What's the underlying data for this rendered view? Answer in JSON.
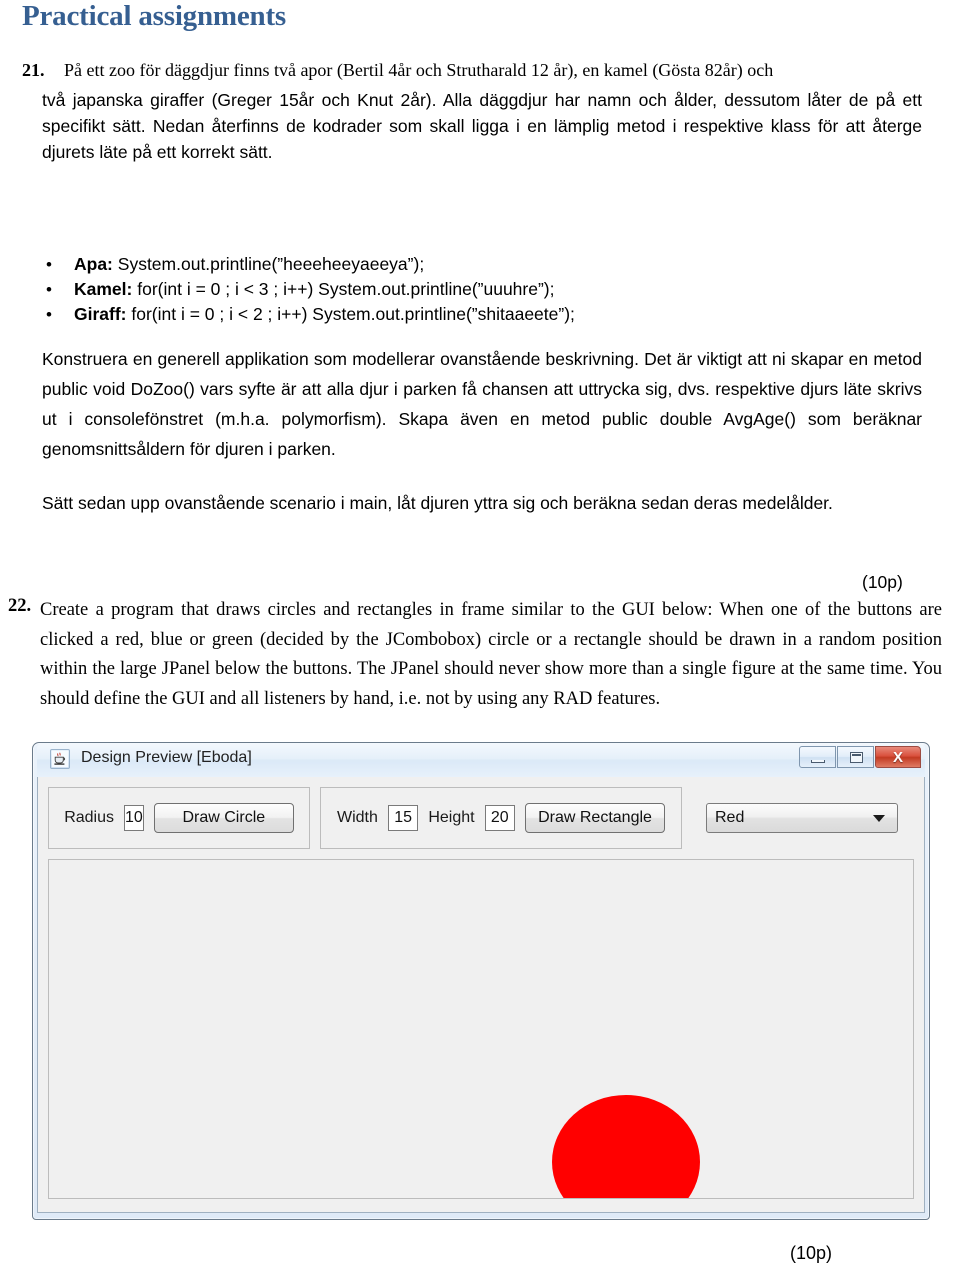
{
  "document": {
    "heading": "Practical assignments",
    "heading_color": "#365F91"
  },
  "question21": {
    "number": "21.",
    "line1": "På ett zoo för däggdjur finns två apor (Bertil 4år och Strutharald 12 år), en kamel (Gösta 82år) och",
    "body": "två japanska giraffer (Greger 15år och Knut 2år). Alla däggdjur har namn och ålder, dessutom låter de på ett specifikt sätt. Nedan återfinns de kodrader som skall ligga i en lämplig metod i respektive klass för att återge djurets läte på ett korrekt sätt.",
    "bullets": [
      {
        "bullet": "•",
        "label": "Apa:",
        "code": "System.out.printline(”heeeheeyaeeya”);"
      },
      {
        "bullet": "•",
        "label": "Kamel:",
        "code": "for(int i = 0 ; i < 3 ; i++)  System.out.printline(”uuuhre”);"
      },
      {
        "bullet": "•",
        "label": "Giraff:",
        "code": "for(int i = 0 ; i < 2 ; i++)  System.out.printline(”shitaaeete”);"
      }
    ],
    "paragraph2": "Konstruera en generell applikation som modellerar ovanstående beskrivning. Det är viktigt att ni skapar en metod public void DoZoo() vars syfte är att alla djur i parken få chansen att uttrycka sig, dvs. respektive djurs läte skrivs ut i consolefönstret (m.h.a. polymorfism). Skapa även en metod public double AvgAge() som beräknar genomsnittsåldern för djuren i parken.",
    "paragraph3": "Sätt sedan upp ovanstående scenario i main, låt djuren yttra sig och beräkna sedan deras medelålder.",
    "points": "(10p)"
  },
  "question22": {
    "number": "22.",
    "body": "Create a program that draws circles and rectangles in frame similar to the GUI below: When one of the buttons are clicked a red, blue or green (decided by the  JCombobox) circle or a rectangle should be drawn in a random position within the large JPanel below the buttons. The JPanel should never show more than a single figure at the same time. You should define the GUI and all listeners by hand, i.e. not by using any RAD features.",
    "points": "(10p)"
  },
  "gui_window": {
    "title": "Design Preview [Eboda]",
    "app_icon": "java-coffee-cup-icon",
    "window_buttons": {
      "minimize": "minimize-icon",
      "maximize": "maximize-icon",
      "close": "X"
    },
    "circle_group": {
      "radius_label": "Radius",
      "radius_value": "10",
      "draw_button": "Draw Circle"
    },
    "rect_group": {
      "width_label": "Width",
      "width_value": "15",
      "height_label": "Height",
      "height_value": "20",
      "draw_button": "Draw Rectangle"
    },
    "color_combo": {
      "selected": "Red",
      "arrow": "chevron-down-icon"
    },
    "canvas": {
      "shape": "ellipse",
      "shape_color": "#FF0000"
    }
  }
}
